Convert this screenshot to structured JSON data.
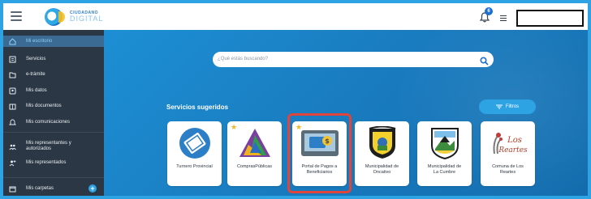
{
  "topbar": {
    "logo_line1": "CIUDADANO",
    "logo_line2": "DIGITAL",
    "notification_count": "6",
    "icons": {
      "menu": "hamburger-icon",
      "notifications": "bell-icon",
      "options": "menu-lines-icon"
    }
  },
  "sidebar": {
    "items": [
      {
        "label": "Mi escritorio",
        "icon": "home-icon",
        "active": true
      },
      {
        "label": "Servicios",
        "icon": "grid-icon"
      },
      {
        "label": "e-trámite",
        "icon": "folder-icon"
      },
      {
        "label": "Mis datos",
        "icon": "id-card-icon"
      },
      {
        "label": "Mis documentos",
        "icon": "documents-icon"
      },
      {
        "label": "Mis comunicaciones",
        "icon": "bell-icon"
      },
      {
        "label_line1": "Mis representantes y",
        "label_line2": "autorizados",
        "icon": "users-icon"
      },
      {
        "label": "Mis representados",
        "icon": "user-plus-icon"
      },
      {
        "label": "Mis carpetas",
        "icon": "folder-icon"
      }
    ]
  },
  "main": {
    "search_placeholder": "¿Qué estás buscando?",
    "section_title": "Servicios sugeridos",
    "filters_label": "Filtros",
    "cards": [
      {
        "line1": "Turnero Provincial",
        "line2": "",
        "icon": "ticket-icon",
        "starred": false
      },
      {
        "line1": "ComprasPúblicas",
        "line2": "",
        "icon": "triangle-logo-icon",
        "starred": true
      },
      {
        "line1": "Portal de Pagos a",
        "line2": "Beneficiarios",
        "icon": "payment-portal-icon",
        "starred": true,
        "highlighted": true
      },
      {
        "line1": "Municipalidad de",
        "line2": "Oncativo",
        "icon": "crest-icon",
        "starred": false
      },
      {
        "line1": "Municipalidad de",
        "line2": "La Cumbre",
        "icon": "crest-icon",
        "starred": false
      },
      {
        "line1": "Comuna de Los",
        "line2": "Reartes",
        "icon": "crest-icon",
        "starred": false,
        "logo_text_1": "Los",
        "logo_text_2": "Reartes"
      }
    ]
  },
  "colors": {
    "frame": "#2ea3e4",
    "sidebar": "#2b3744",
    "sidebar_active": "#3b6a92",
    "main_bg": "#1a7dc1",
    "highlight": "#e0443a",
    "star": "#f5b71c"
  }
}
